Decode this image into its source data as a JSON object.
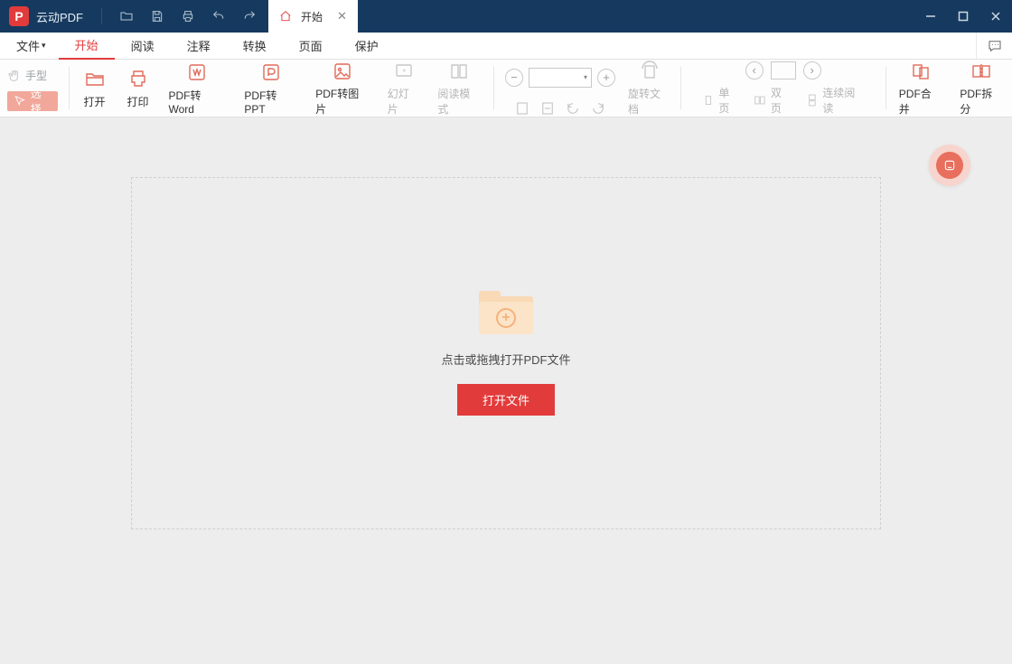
{
  "app": {
    "name": "云动PDF"
  },
  "titlebar_tab": {
    "label": "开始"
  },
  "menus": {
    "file": "文件",
    "items": [
      "开始",
      "阅读",
      "注释",
      "转换",
      "页面",
      "保护"
    ],
    "active_index": 0
  },
  "ribbon": {
    "hand": "手型",
    "select": "选择",
    "open": "打开",
    "print": "打印",
    "to_word": "PDF转Word",
    "to_ppt": "PDF转PPT",
    "to_image": "PDF转图片",
    "slideshow": "幻灯片",
    "read_mode": "阅读模式",
    "rotate_doc": "旋转文档",
    "single_page": "单页",
    "double_page": "双页",
    "continuous": "连续阅读",
    "merge": "PDF合并",
    "split": "PDF拆分",
    "zoom_value": ""
  },
  "workspace": {
    "hint": "点击或拖拽打开PDF文件",
    "open_button": "打开文件"
  }
}
